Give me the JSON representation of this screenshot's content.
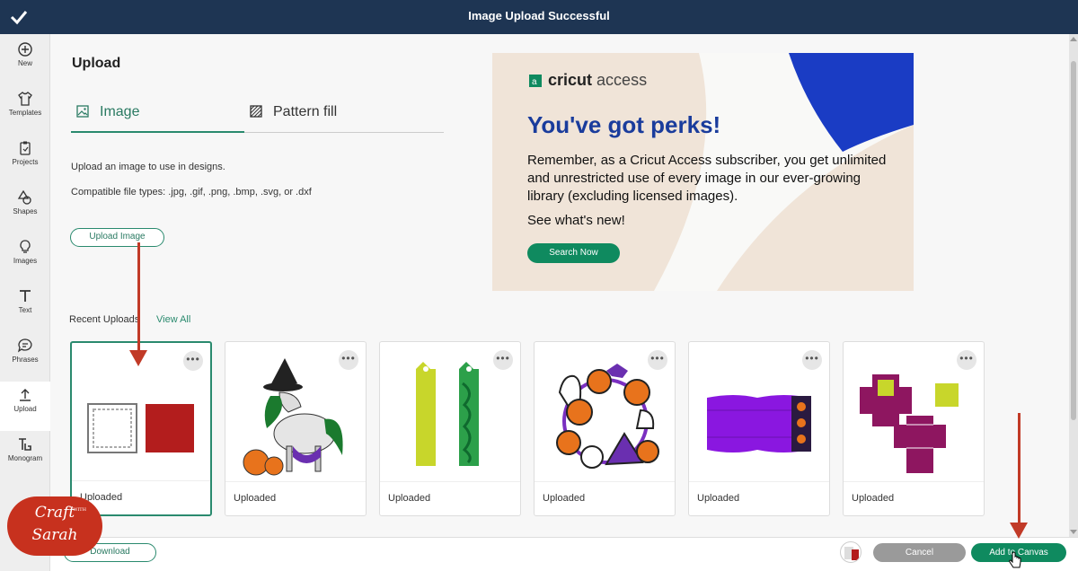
{
  "topbar": {
    "title": "Image Upload Successful"
  },
  "sidebar": {
    "items": [
      {
        "label": "New",
        "icon": "plus-circle-icon"
      },
      {
        "label": "Templates",
        "icon": "tshirt-icon"
      },
      {
        "label": "Projects",
        "icon": "clipboard-icon"
      },
      {
        "label": "Shapes",
        "icon": "shapes-icon"
      },
      {
        "label": "Images",
        "icon": "lightbulb-icon"
      },
      {
        "label": "Text",
        "icon": "text-icon"
      },
      {
        "label": "Phrases",
        "icon": "speech-bubble-icon"
      },
      {
        "label": "Upload",
        "icon": "upload-icon"
      },
      {
        "label": "Monogram",
        "icon": "monogram-icon"
      }
    ]
  },
  "upload": {
    "heading": "Upload",
    "tabs": [
      {
        "label": "Image"
      },
      {
        "label": "Pattern fill"
      }
    ],
    "description": "Upload an image to use in designs.",
    "file_types": "Compatible file types: .jpg, .gif, .png, .bmp, .svg, or .dxf",
    "upload_button": "Upload Image"
  },
  "ad": {
    "logo_brand": "cricut",
    "logo_product": "access",
    "heading": "You've got perks!",
    "body": "Remember, as a Cricut Access subscriber, you get unlimited and unrestricted use of every image in our ever-growing library (excluding licensed images).",
    "whats_new": "See what's new!",
    "cta": "Search Now"
  },
  "recent": {
    "title": "Recent Uploads",
    "view_all": "View All",
    "cards": [
      {
        "label": "Uploaded",
        "menu": "•••"
      },
      {
        "label": "Uploaded",
        "menu": "•••"
      },
      {
        "label": "Uploaded",
        "menu": "•••"
      },
      {
        "label": "Uploaded",
        "menu": "•••"
      },
      {
        "label": "Uploaded",
        "menu": "•••"
      },
      {
        "label": "Uploaded",
        "menu": "•••"
      }
    ]
  },
  "bottom": {
    "download": "Download",
    "cancel": "Cancel",
    "add_to_canvas": "Add to Canvas"
  },
  "watermark": {
    "line1": "Craft",
    "with": "WITH",
    "line2": "Sarah"
  },
  "colors": {
    "topbar": "#1e3553",
    "accent": "#2a8a6e",
    "primary_button": "#0f8a5f",
    "ad_heading": "#1a3c9c",
    "arrow": "#c13a27"
  }
}
